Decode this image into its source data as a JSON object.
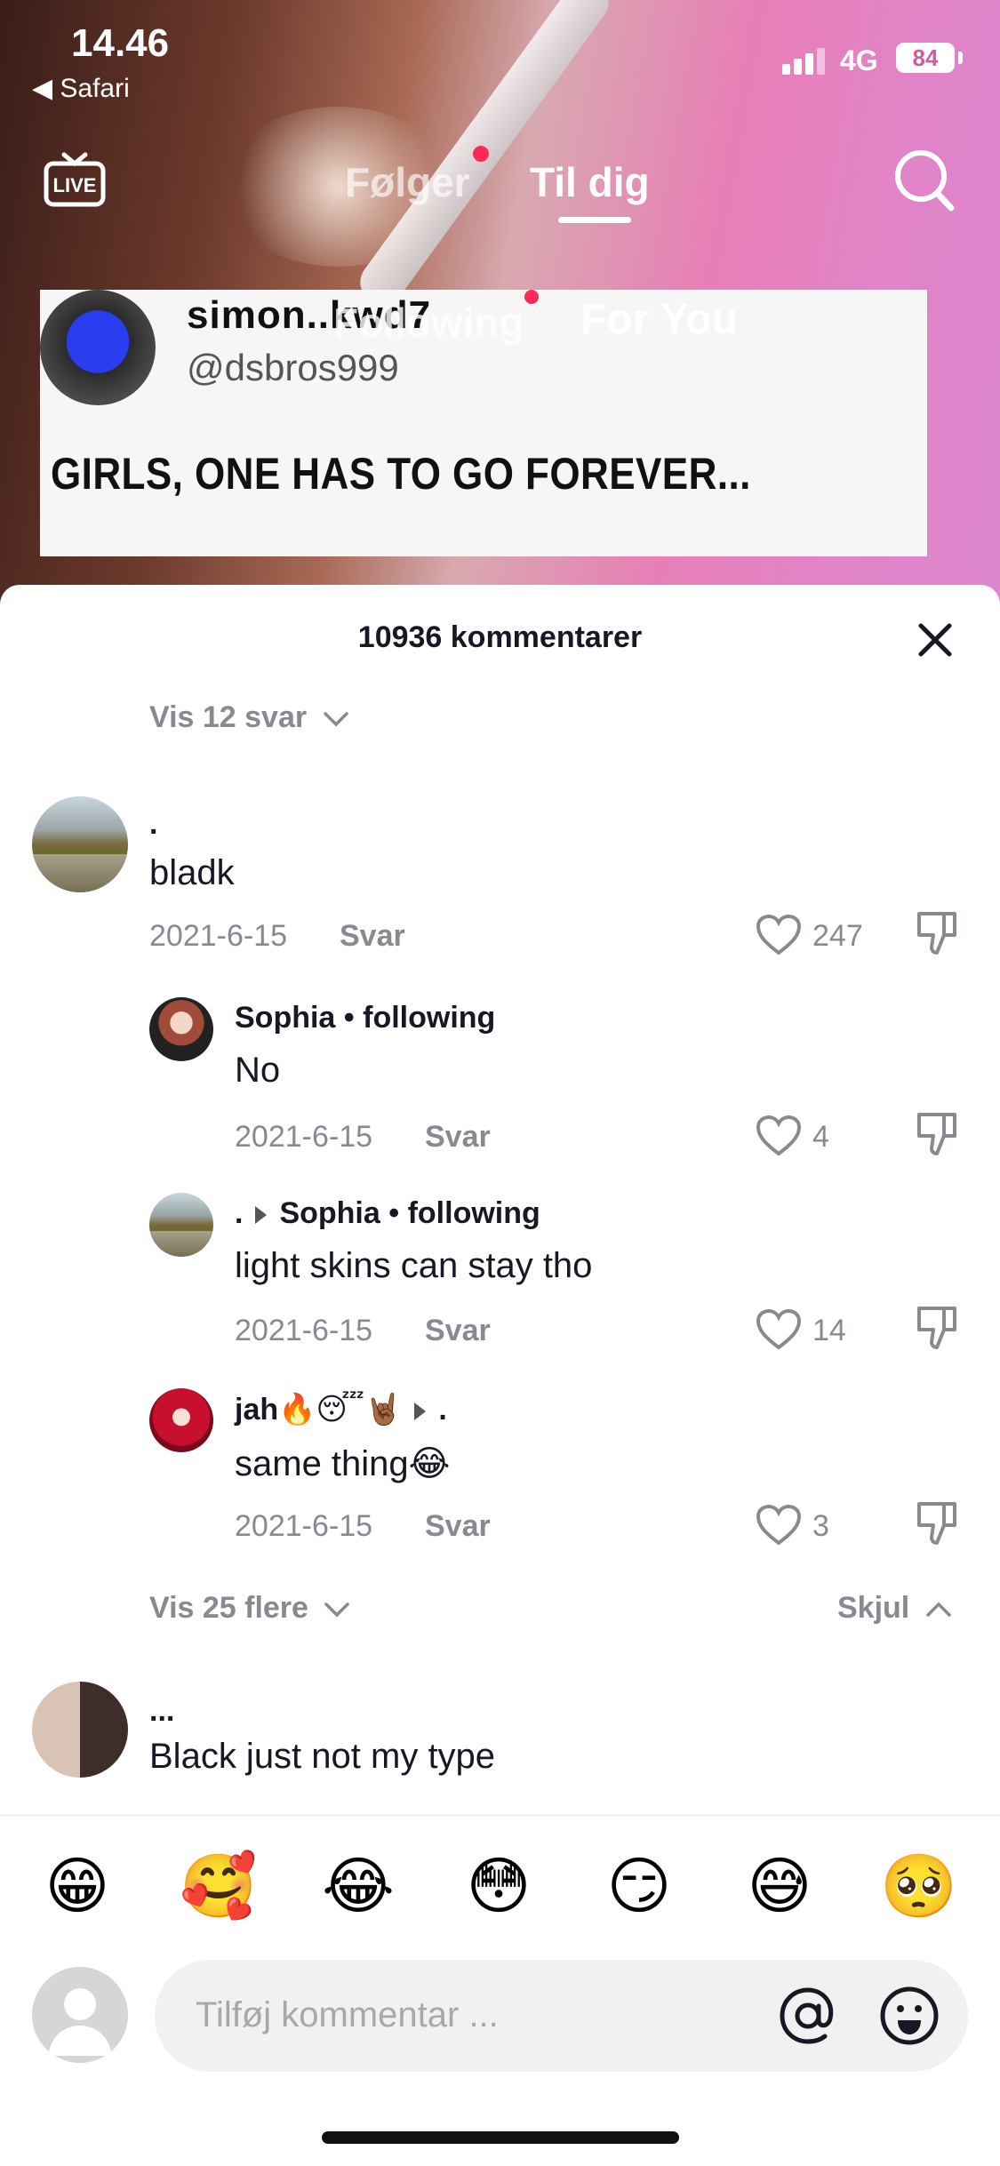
{
  "status_bar": {
    "time": "14.46",
    "back_app": "Safari",
    "network": "4G",
    "battery": "84"
  },
  "top_nav": {
    "tabs": [
      {
        "label": "Følger"
      },
      {
        "label": "Til dig"
      }
    ],
    "live_label": "LIVE"
  },
  "video_card": {
    "username": "simon..kwd7",
    "handle": "@dsbros999",
    "overlay_following": "Following",
    "overlay_for_you": "For You",
    "headline": "GIRLS, ONE HAS TO GO FOREVER..."
  },
  "comments_sheet": {
    "title": "10936 kommentarer",
    "view_replies": "Vis 12 svar",
    "comments": [
      {
        "username": ".",
        "text": "bladk",
        "date": "2021-6-15",
        "reply_label": "Svar",
        "likes": "247"
      }
    ],
    "replies": [
      {
        "username": "Sophia • following",
        "text": "No",
        "date": "2021-6-15",
        "reply_label": "Svar",
        "likes": "4"
      },
      {
        "username": ".",
        "reply_to": "Sophia • following",
        "text": "light skins can stay tho",
        "date": "2021-6-15",
        "reply_label": "Svar",
        "likes": "14"
      },
      {
        "username": "jah🔥😴🤘🏾",
        "reply_to": ".",
        "text": "same thing😂",
        "date": "2021-6-15",
        "reply_label": "Svar",
        "likes": "3"
      }
    ],
    "view_more": "Vis 25 flere",
    "hide": "Skjul",
    "next_comment": {
      "username": "...",
      "text": "Black just not my type"
    }
  },
  "composer": {
    "emojis": [
      "😁",
      "🥰",
      "😂",
      "😳",
      "😏",
      "😅",
      "🥺"
    ],
    "placeholder": "Tilføj kommentar ..."
  },
  "colors": {
    "accent_red": "#fe2c55",
    "muted_text": "#888a92",
    "primary_text": "#161823"
  }
}
